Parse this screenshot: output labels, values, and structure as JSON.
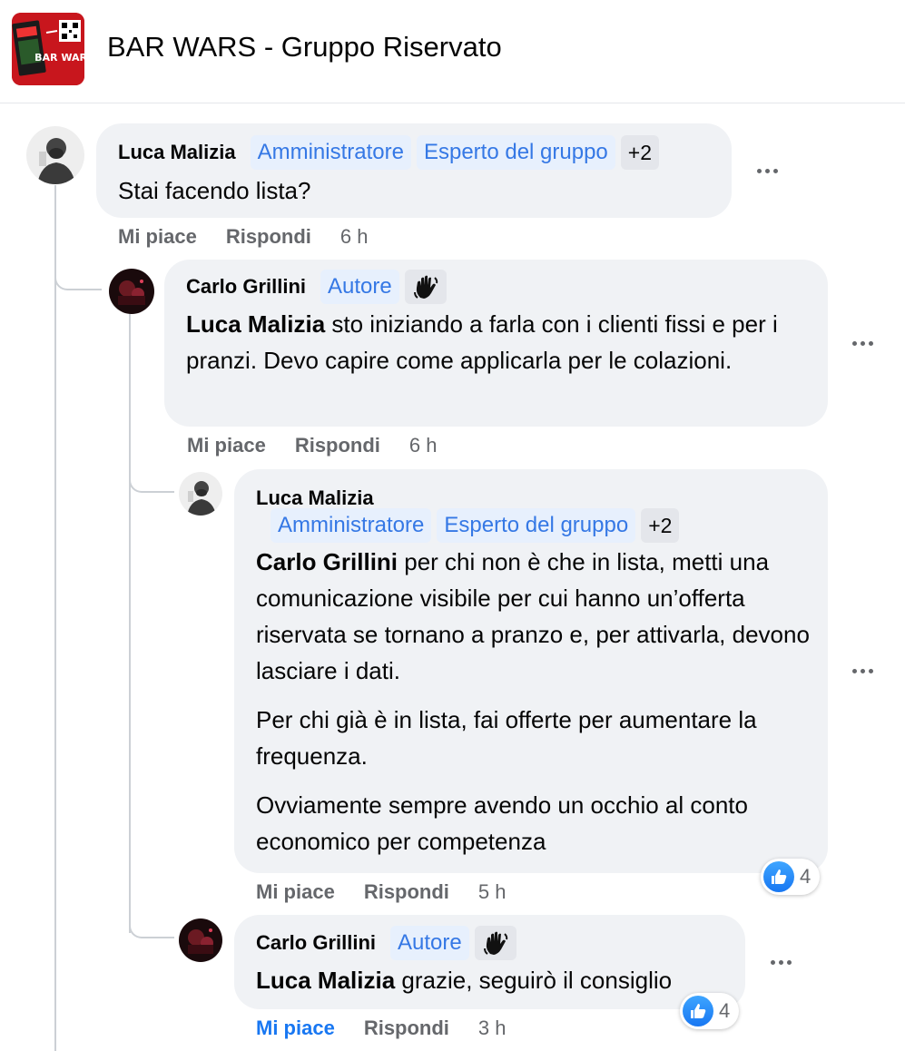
{
  "header": {
    "group_title": "BAR WARS - Gruppo Riservato",
    "logo_text": "BAR WARS"
  },
  "comments": [
    {
      "author": "Luca Malizia",
      "badges": [
        "Amministratore",
        "Esperto del gruppo"
      ],
      "badge_more": "+2",
      "text": "Stai facendo lista?",
      "like_label": "Mi piace",
      "reply_label": "Rispondi",
      "time": "6 h"
    },
    {
      "author": "Carlo Grillini",
      "badges": [
        "Autore"
      ],
      "mention": "Luca Malizia",
      "text": " sto iniziando a farla con i clienti fissi e per i pranzi. Devo capire come applicarla per le colazioni.",
      "like_label": "Mi piace",
      "reply_label": "Rispondi",
      "time": "6 h"
    },
    {
      "author": "Luca Malizia",
      "badges": [
        "Amministratore",
        "Esperto del gruppo"
      ],
      "badge_more": "+2",
      "mention": "Carlo Grillini",
      "paragraphs": [
        " per chi non è che in lista, metti una comunicazione visibile per cui hanno un’offerta riservata se tornano a pranzo e, per attivarla, devono lasciare i dati.",
        "Per chi già è in lista, fai offerte per aumentare la frequenza.",
        "Ovviamente sempre avendo un occhio al conto economico per competenza"
      ],
      "reaction_count": "4",
      "like_label": "Mi piace",
      "reply_label": "Rispondi",
      "time": "5 h"
    },
    {
      "author": "Carlo Grillini",
      "badges": [
        "Autore"
      ],
      "mention": "Luca Malizia",
      "text": " grazie, seguirò il consiglio",
      "reaction_count": "4",
      "like_label": "Mi piace",
      "reply_label": "Rispondi",
      "time": "3 h"
    }
  ],
  "colors": {
    "badge_text": "#3578e5",
    "badge_bg": "#e7f0fd",
    "bubble_bg": "#f0f2f5",
    "like_blue": "#1877f2",
    "meta_gray": "#65676b"
  },
  "icons": [
    "more-options-icon",
    "wave-hand-icon",
    "like-thumb-icon"
  ]
}
